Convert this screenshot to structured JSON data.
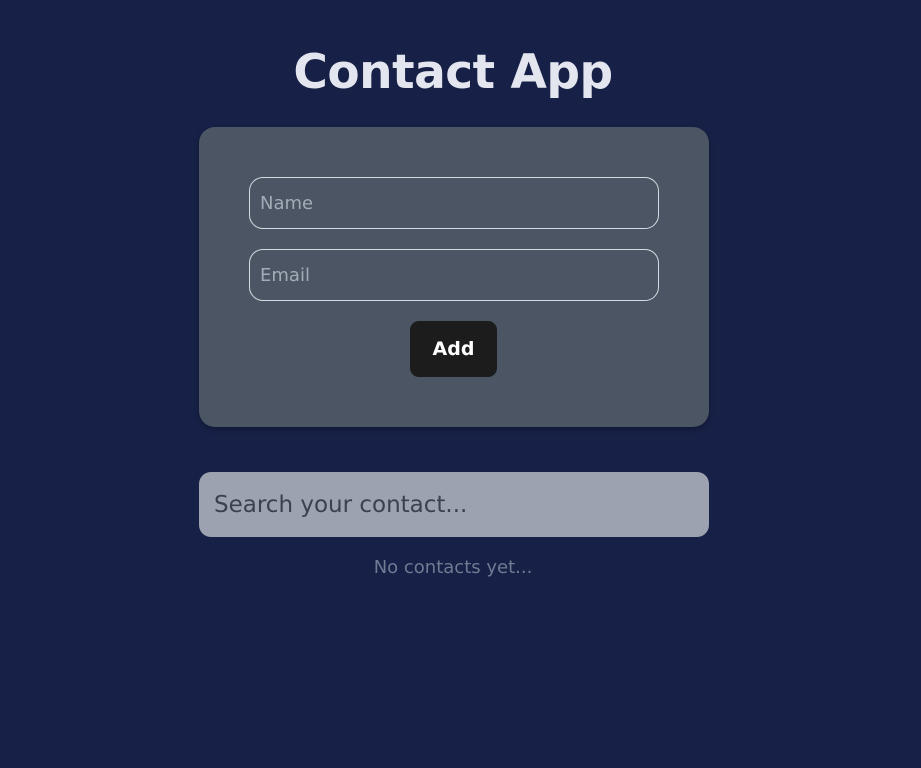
{
  "header": {
    "title": "Contact App"
  },
  "form": {
    "name_placeholder": "Name",
    "email_placeholder": "Email",
    "add_label": "Add"
  },
  "search": {
    "placeholder": "Search your contact..."
  },
  "contacts": {
    "empty_message": "No contacts yet..."
  },
  "colors": {
    "background": "#172046",
    "card": "#4b5563",
    "button": "#1c1c1c",
    "search_bg": "#9ca2af"
  }
}
